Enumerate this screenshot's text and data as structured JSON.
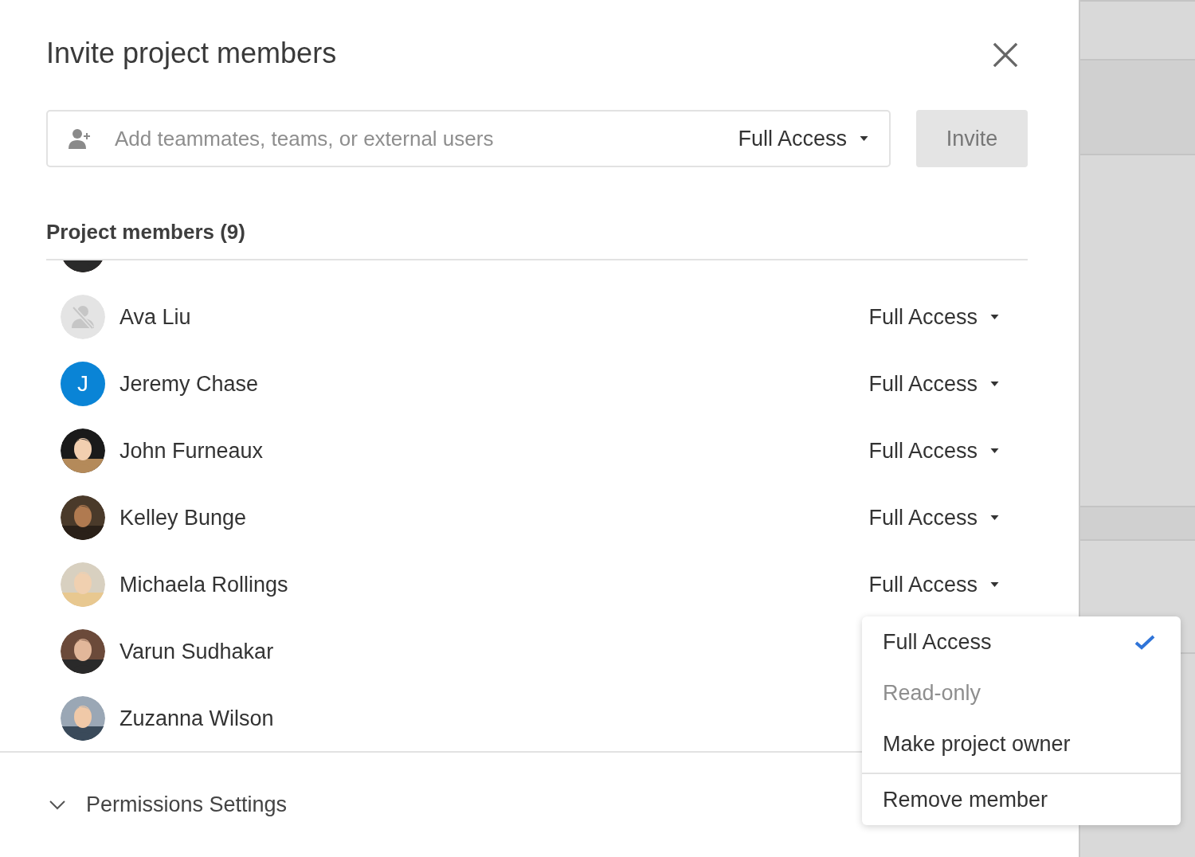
{
  "dialog": {
    "title": "Invite project members"
  },
  "invite": {
    "placeholder": "Add teammates, teams, or external users",
    "access": "Full Access",
    "button": "Invite"
  },
  "members": {
    "heading": "Project members (9)",
    "rows": [
      {
        "avatar": {
          "kind": "picture"
        }
      },
      {
        "name": "Ava Liu",
        "avatar": {
          "kind": "placeholder"
        },
        "access": "Full Access"
      },
      {
        "name": "Jeremy Chase",
        "avatar": {
          "kind": "initial",
          "initial": "J",
          "color": "#0a84d6"
        },
        "access": "Full Access"
      },
      {
        "name": "John Furneaux",
        "avatar": {
          "kind": "picture"
        },
        "access": "Full Access"
      },
      {
        "name": "Kelley Bunge",
        "avatar": {
          "kind": "picture"
        },
        "access": "Full Access"
      },
      {
        "name": "Michaela Rollings",
        "avatar": {
          "kind": "picture"
        },
        "access": "Full Access"
      },
      {
        "name": "Varun Sudhakar",
        "avatar": {
          "kind": "picture"
        }
      },
      {
        "name": "Zuzanna Wilson",
        "avatar": {
          "kind": "picture"
        }
      }
    ]
  },
  "menu": {
    "items": [
      {
        "label": "Full Access",
        "selected": true,
        "disabled": false
      },
      {
        "label": "Read-only",
        "selected": false,
        "disabled": true
      },
      {
        "label": "Make project owner",
        "selected": false,
        "disabled": false
      },
      {
        "label": "Remove member",
        "selected": false,
        "disabled": false,
        "separated": true
      }
    ]
  },
  "footer": {
    "label": "Permissions Settings",
    "expanded": false
  }
}
